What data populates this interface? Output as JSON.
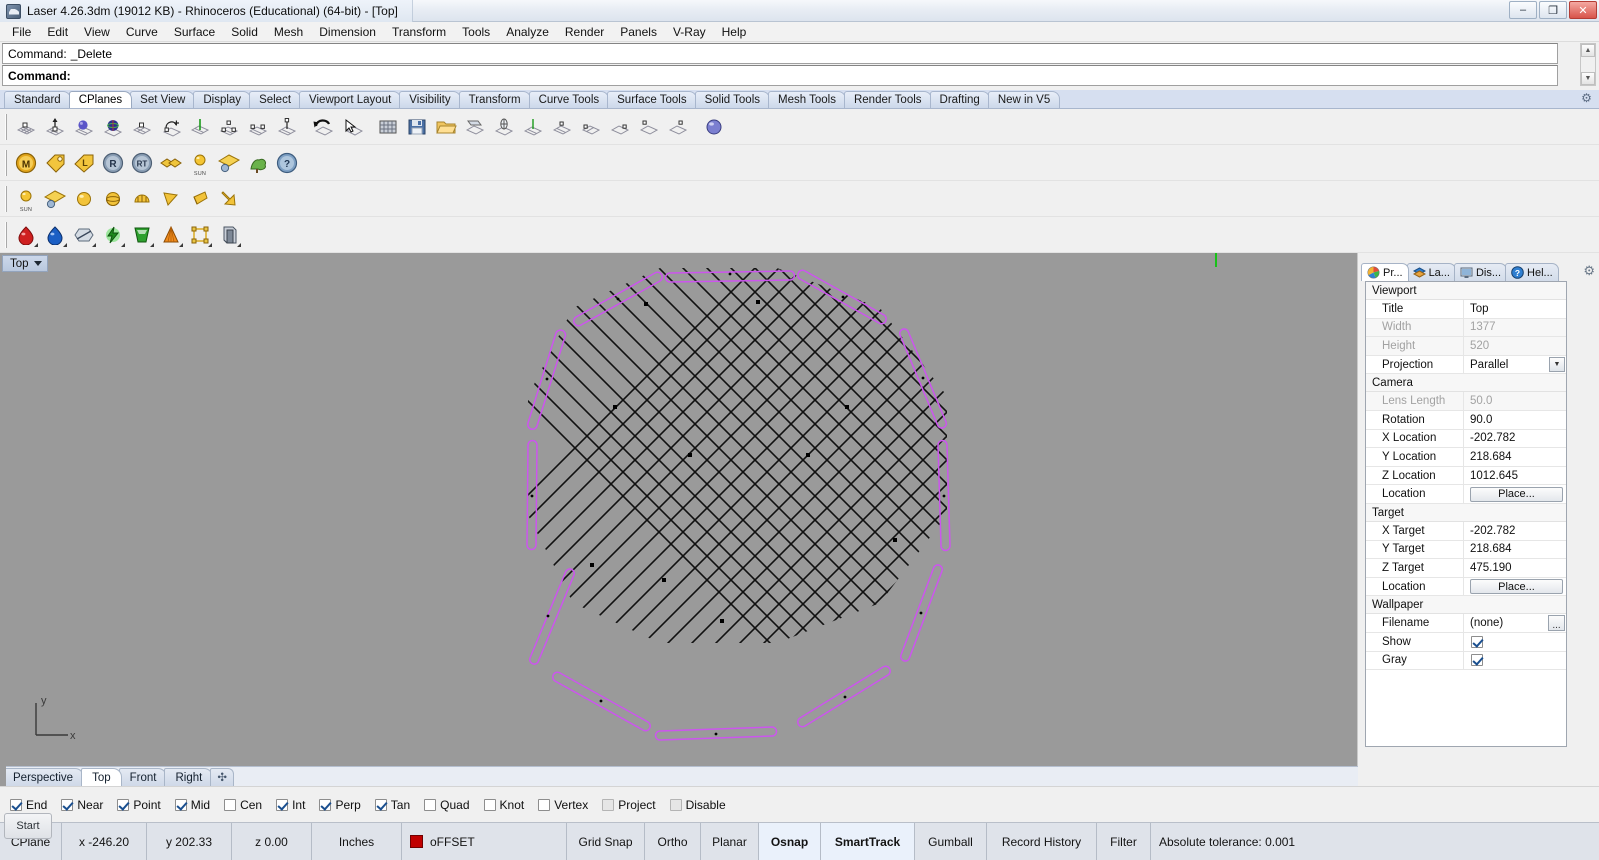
{
  "window": {
    "title": "Laser 4.26.3dm (19012 KB) - Rhinoceros (Educational) (64-bit) - [Top]",
    "minimize": "–",
    "maximize": "❐",
    "close": "✕"
  },
  "menubar": {
    "items": [
      "File",
      "Edit",
      "View",
      "Curve",
      "Surface",
      "Solid",
      "Mesh",
      "Dimension",
      "Transform",
      "Tools",
      "Analyze",
      "Render",
      "Panels",
      "V-Ray",
      "Help"
    ]
  },
  "command": {
    "history_label": "Command:",
    "history_value": "_Delete",
    "prompt_label": "Command:",
    "prompt_value": "",
    "scroll_up": "▲",
    "scroll_down": "▼"
  },
  "toolbar_tabs": {
    "items": [
      "Standard",
      "CPlanes",
      "Set View",
      "Display",
      "Select",
      "Viewport Layout",
      "Visibility",
      "Transform",
      "Curve Tools",
      "Surface Tools",
      "Solid Tools",
      "Mesh Tools",
      "Render Tools",
      "Drafting",
      "New in V5"
    ],
    "active": "CPlanes",
    "options_icon": "⚙"
  },
  "toolbar_rows": [
    {
      "name": "cplanes-toolbar",
      "buttons": [
        "cplane-origin-icon",
        "cplane-elevation-icon",
        "cplane-object-icon",
        "cplane-surface-icon",
        "cplane-curve-icon",
        "cplane-rotate-icon",
        "cplane-vertical-icon",
        "cplane-3point-icon",
        "cplane-perp-curve-icon",
        "cplane-to-view-icon",
        "sep",
        "cplane-undo-icon",
        "cplane-next-icon"
      ]
    },
    {
      "name": "vray-main-toolbar",
      "buttons": [
        "vray-material-editor-icon",
        "vray-options-icon",
        "vray-light-lister-icon",
        "vray-render-icon",
        "vray-render-rt-icon",
        "vray-frame-buffer-icon",
        "vray-sun-icon",
        "vray-infinite-plane-icon",
        "vray-proxy-icon",
        "vray-help-icon"
      ]
    },
    {
      "name": "vray-lights-toolbar",
      "buttons": [
        "vray-sun-light-icon",
        "vray-plane-light-icon",
        "vray-sphere-light-icon",
        "vray-dome-light-icon",
        "vray-mesh-light-icon",
        "vray-ies-light-icon",
        "vray-spot-light-icon",
        "vray-directional-light-icon"
      ]
    },
    {
      "name": "vray-objects-toolbar",
      "buttons": [
        "vray-red-material-icon",
        "vray-blue-material-icon",
        "vray-clipper-icon",
        "vray-fur-icon",
        "vray-displacement-icon",
        "vray-proxy-mesh-icon",
        "vray-mesh-cage-icon",
        "vray-instancer-icon"
      ]
    }
  ],
  "viewport": {
    "label": "Top",
    "dropdown_icon": "chevron-down-icon",
    "axis_x": "x",
    "axis_y": "y",
    "background_color": "#9a9a9a",
    "geometry_outline_color": "#cc55ee",
    "geometry_hatch_color": "#101010"
  },
  "viewport_tabs": {
    "items": [
      "Perspective",
      "Top",
      "Front",
      "Right"
    ],
    "active": "Top",
    "add_label": "✣"
  },
  "osnap": {
    "items": [
      {
        "label": "End",
        "checked": true,
        "enabled": true
      },
      {
        "label": "Near",
        "checked": true,
        "enabled": true
      },
      {
        "label": "Point",
        "checked": true,
        "enabled": true
      },
      {
        "label": "Mid",
        "checked": true,
        "enabled": true
      },
      {
        "label": "Cen",
        "checked": false,
        "enabled": true
      },
      {
        "label": "Int",
        "checked": true,
        "enabled": true
      },
      {
        "label": "Perp",
        "checked": true,
        "enabled": true
      },
      {
        "label": "Tan",
        "checked": true,
        "enabled": true
      },
      {
        "label": "Quad",
        "checked": false,
        "enabled": true
      },
      {
        "label": "Knot",
        "checked": false,
        "enabled": true
      },
      {
        "label": "Vertex",
        "checked": false,
        "enabled": true
      },
      {
        "label": "Project",
        "checked": false,
        "enabled": false
      },
      {
        "label": "Disable",
        "checked": false,
        "enabled": false
      }
    ]
  },
  "taskbar": {
    "start_label": "Start"
  },
  "statusbar": {
    "cplane_label": "CPlane",
    "x": "x -246.20",
    "y": "y 202.33",
    "z": "z 0.00",
    "units": "Inches",
    "layer_color": "#c00000",
    "layer": "oFFSET",
    "toggles": [
      {
        "label": "Grid Snap",
        "active": false
      },
      {
        "label": "Ortho",
        "active": false
      },
      {
        "label": "Planar",
        "active": false
      },
      {
        "label": "Osnap",
        "active": true
      },
      {
        "label": "SmartTrack",
        "active": true
      },
      {
        "label": "Gumball",
        "active": false
      },
      {
        "label": "Record History",
        "active": false
      },
      {
        "label": "Filter",
        "active": false
      }
    ],
    "tolerance": "Absolute tolerance: 0.001"
  },
  "right_panel": {
    "tabs": [
      {
        "label": "Pr...",
        "icon": "properties-icon",
        "active": true
      },
      {
        "label": "La...",
        "icon": "layers-icon",
        "active": false
      },
      {
        "label": "Dis...",
        "icon": "display-icon",
        "active": false
      },
      {
        "label": "Hel...",
        "icon": "help-icon",
        "active": false
      }
    ],
    "options_icon": "⚙",
    "groups": [
      {
        "title": "Viewport",
        "rows": [
          {
            "key": "Title",
            "value": "Top",
            "type": "text",
            "dim": false
          },
          {
            "key": "Width",
            "value": "1377",
            "type": "text",
            "dim": true
          },
          {
            "key": "Height",
            "value": "520",
            "type": "text",
            "dim": true
          },
          {
            "key": "Projection",
            "value": "Parallel",
            "type": "dropdown",
            "dim": false
          }
        ]
      },
      {
        "title": "Camera",
        "rows": [
          {
            "key": "Lens Length",
            "value": "50.0",
            "type": "text",
            "dim": true
          },
          {
            "key": "Rotation",
            "value": "90.0",
            "type": "text",
            "dim": false
          },
          {
            "key": "X Location",
            "value": "-202.782",
            "type": "text",
            "dim": false
          },
          {
            "key": "Y Location",
            "value": "218.684",
            "type": "text",
            "dim": false
          },
          {
            "key": "Z Location",
            "value": "1012.645",
            "type": "text",
            "dim": false
          },
          {
            "key": "Location",
            "value": "Place...",
            "type": "button",
            "dim": false
          }
        ]
      },
      {
        "title": "Target",
        "rows": [
          {
            "key": "X Target",
            "value": "-202.782",
            "type": "text",
            "dim": false
          },
          {
            "key": "Y Target",
            "value": "218.684",
            "type": "text",
            "dim": false
          },
          {
            "key": "Z Target",
            "value": "475.190",
            "type": "text",
            "dim": false
          },
          {
            "key": "Location",
            "value": "Place...",
            "type": "button",
            "dim": false
          }
        ]
      },
      {
        "title": "Wallpaper",
        "rows": [
          {
            "key": "Filename",
            "value": "(none)",
            "type": "file",
            "dim": false
          },
          {
            "key": "Show",
            "value": "",
            "type": "checkbox",
            "dim": false
          },
          {
            "key": "Gray",
            "value": "",
            "type": "checkbox",
            "dim": false
          }
        ]
      }
    ]
  }
}
